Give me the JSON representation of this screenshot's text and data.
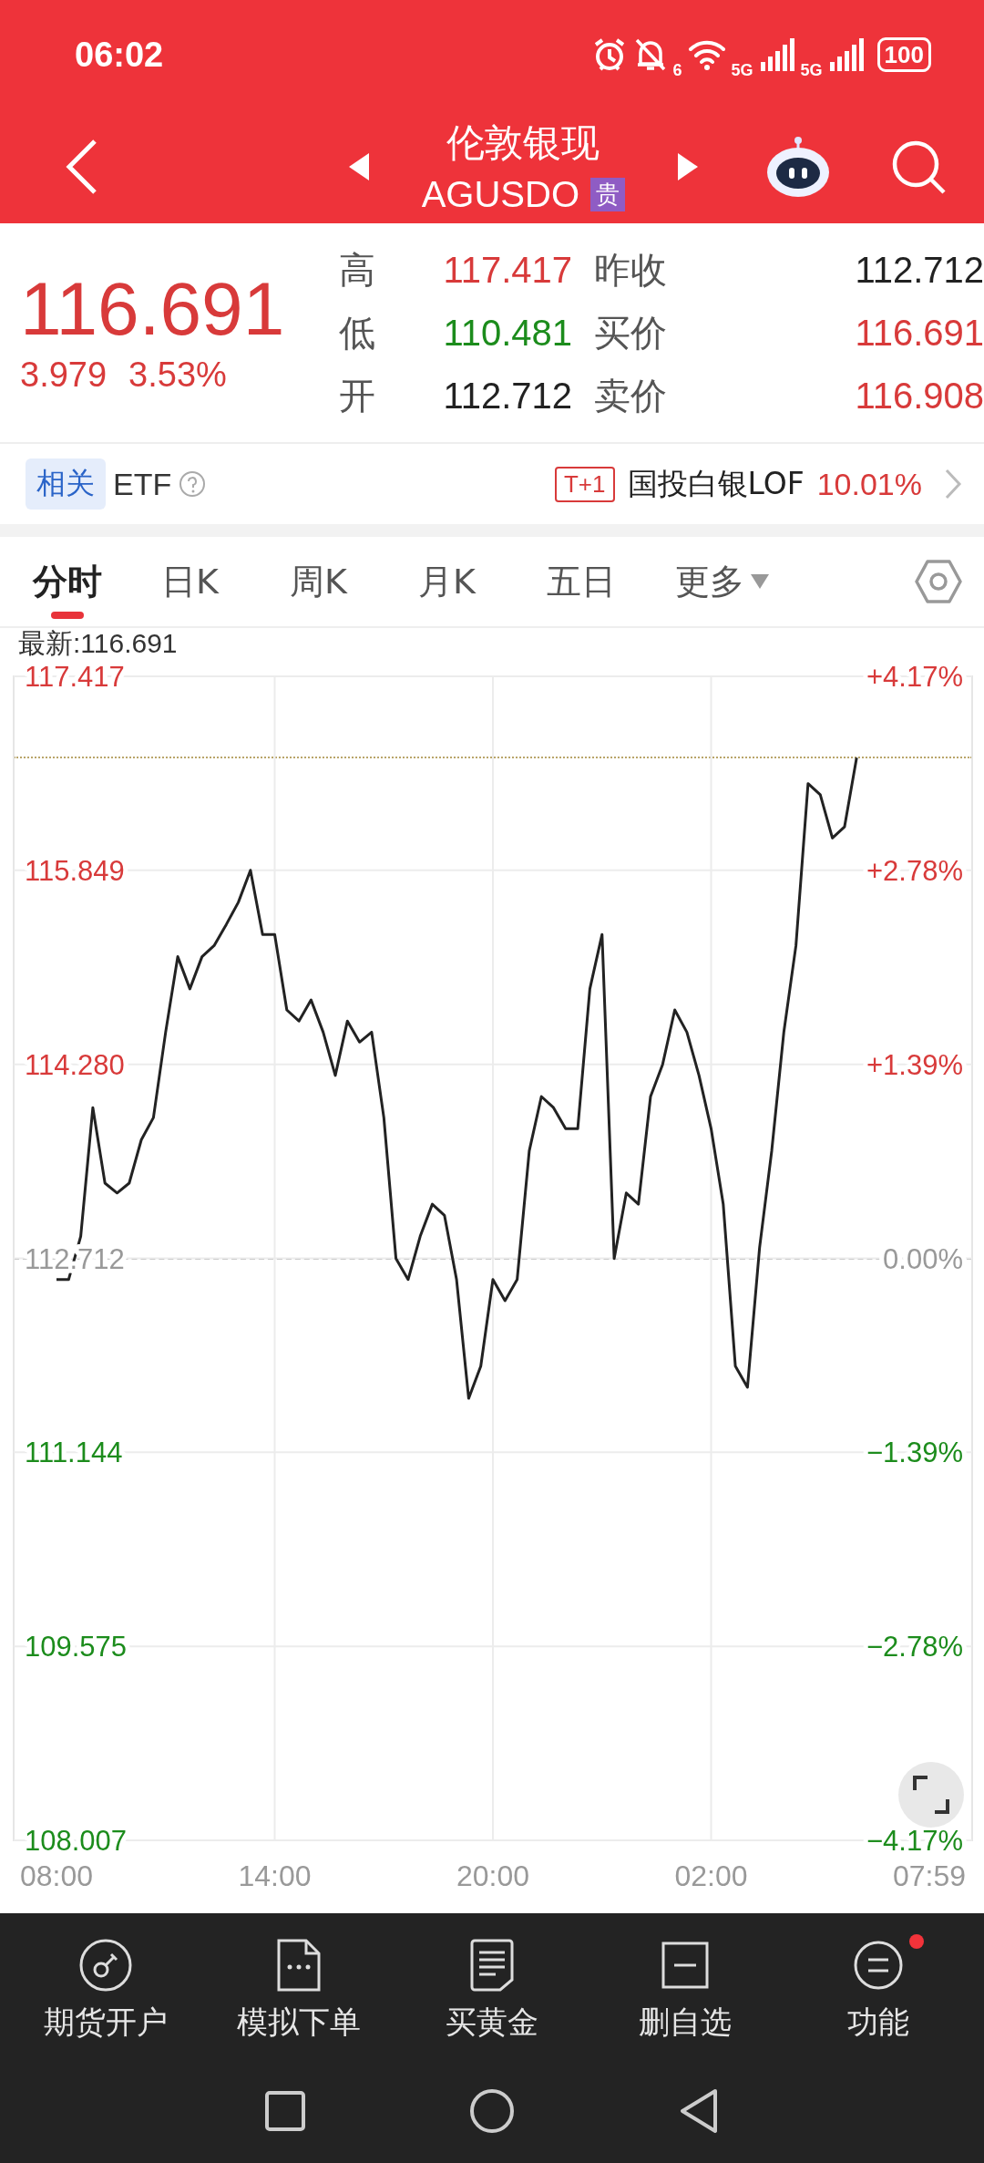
{
  "status_bar": {
    "time": "06:02",
    "wifi_label": "6",
    "signals": [
      "5G",
      "5G"
    ],
    "battery": "100"
  },
  "header": {
    "title": "伦敦银现",
    "code": "AGUSDO",
    "tag": "贵"
  },
  "quote": {
    "price": "116.691",
    "change": "3.979",
    "change_pct": "3.53%",
    "color": "#d83a3a",
    "stats": [
      {
        "label": "高",
        "value": "117.417",
        "color": "#d83a3a"
      },
      {
        "label": "昨收",
        "value": "112.712",
        "color": "#222222"
      },
      {
        "label": "低",
        "value": "110.481",
        "color": "#1c8c1c"
      },
      {
        "label": "买价",
        "value": "116.691",
        "color": "#d83a3a"
      },
      {
        "label": "开",
        "value": "112.712",
        "color": "#222222"
      },
      {
        "label": "卖价",
        "value": "116.908",
        "color": "#d83a3a"
      }
    ]
  },
  "etf": {
    "chip": "相关",
    "label": "ETF",
    "fund_tag": "T+1",
    "fund_name": "国投白银LOF",
    "fund_change": "10.01%"
  },
  "tabs": [
    {
      "label": "分时",
      "selected": true,
      "dropdown": false
    },
    {
      "label": "日K",
      "selected": false,
      "dropdown": false
    },
    {
      "label": "周K",
      "selected": false,
      "dropdown": false
    },
    {
      "label": "月K",
      "selected": false,
      "dropdown": false
    },
    {
      "label": "五日",
      "selected": false,
      "dropdown": false
    },
    {
      "label": "更多",
      "selected": false,
      "dropdown": true
    }
  ],
  "chart": {
    "latest_label": "最新:116.691",
    "percent_labels": [
      {
        "label": "+4.17%",
        "color": "#d83a3a"
      },
      {
        "label": "+2.78%",
        "color": "#d83a3a"
      },
      {
        "label": "+1.39%",
        "color": "#d83a3a"
      },
      {
        "label": "0.00%",
        "color": "#999999"
      },
      {
        "label": "−1.39%",
        "color": "#1c8c1c"
      },
      {
        "label": "−2.78%",
        "color": "#1c8c1c"
      },
      {
        "label": "−4.17%",
        "color": "#1c8c1c"
      }
    ],
    "chart_data": {
      "type": "line",
      "categories": [
        "08:00",
        null,
        null,
        null,
        null,
        null,
        null,
        null,
        null,
        null,
        null,
        null,
        null,
        null,
        null,
        null,
        null,
        null,
        "14:00",
        null,
        null,
        null,
        null,
        null,
        null,
        null,
        null,
        null,
        null,
        null,
        null,
        null,
        null,
        null,
        null,
        null,
        "20:00",
        null,
        null,
        null,
        null,
        null,
        null,
        null,
        null,
        null,
        null,
        null,
        null,
        null,
        null,
        null,
        null,
        null,
        "02:00",
        null,
        null,
        null,
        null,
        null,
        null,
        null,
        null,
        null,
        null,
        null,
        null,
        null,
        null,
        null,
        null,
        null,
        "07:59"
      ],
      "values": [
        112.54,
        112.54,
        112.89,
        113.93,
        113.32,
        113.24,
        113.32,
        113.67,
        113.85,
        114.54,
        115.15,
        114.89,
        115.15,
        115.24,
        115.41,
        115.59,
        115.85,
        115.33,
        115.33,
        114.72,
        114.63,
        114.8,
        114.54,
        114.19,
        114.63,
        114.46,
        114.54,
        113.85,
        112.71,
        112.54,
        112.89,
        113.15,
        113.06,
        112.54,
        111.58,
        111.84,
        112.54,
        112.37,
        112.54,
        113.58,
        114.02,
        113.93,
        113.76,
        113.76,
        114.89,
        115.33,
        112.71,
        113.24,
        113.15,
        114.02,
        114.28,
        114.72,
        114.54,
        114.19,
        113.76,
        113.15,
        111.84,
        111.67,
        112.8,
        113.58,
        114.54,
        115.24,
        116.55,
        116.46,
        116.11,
        116.2,
        116.76,
        null,
        null,
        null,
        null,
        null,
        null
      ],
      "grid": true,
      "ylim": [
        108.007,
        117.417
      ],
      "yticks": [
        {
          "value": 117.417,
          "label": "117.417"
        },
        {
          "value": 115.849,
          "label": "115.849"
        },
        {
          "value": 114.28,
          "label": "114.280"
        },
        {
          "value": 112.712,
          "label": "112.712"
        },
        {
          "value": 111.144,
          "label": "111.144"
        },
        {
          "value": 109.575,
          "label": "109.575"
        },
        {
          "value": 108.007,
          "label": "108.007"
        }
      ]
    }
  },
  "bottom_nav": [
    {
      "label": "期货开户",
      "kind": "key",
      "badge": false
    },
    {
      "label": "模拟下单",
      "kind": "doc",
      "badge": false
    },
    {
      "label": "买黄金",
      "kind": "note",
      "badge": false
    },
    {
      "label": "删自选",
      "kind": "minus-box",
      "badge": false
    },
    {
      "label": "功能",
      "kind": "menu-circle",
      "badge": true
    }
  ]
}
